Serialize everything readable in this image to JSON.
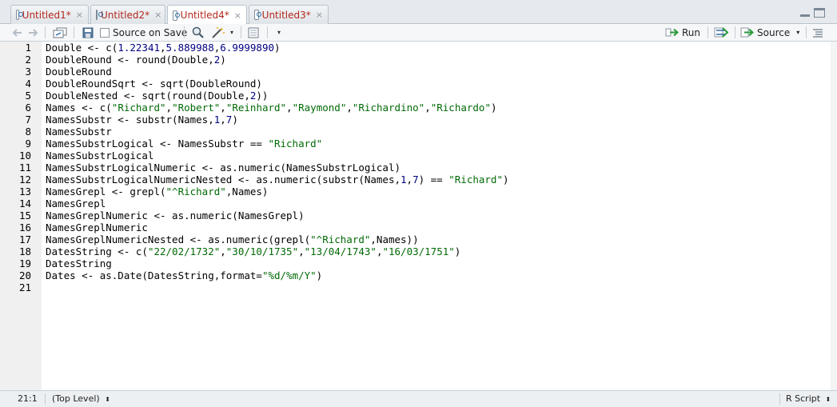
{
  "tabs": [
    {
      "label": "Untitled1*",
      "close": "×"
    },
    {
      "label": "Untitled2*",
      "close": "×"
    },
    {
      "label": "Untitled4*",
      "close": "×"
    },
    {
      "label": "Untitled3*",
      "close": "×"
    }
  ],
  "toolbar": {
    "source_on_save_label": "Source on Save",
    "run_label": "Run",
    "source_label": "Source"
  },
  "code": {
    "lines": [
      [
        {
          "t": "Double <- c("
        },
        {
          "t": "1.22341",
          "c": "n"
        },
        {
          "t": ","
        },
        {
          "t": "5.889988",
          "c": "n"
        },
        {
          "t": ","
        },
        {
          "t": "6.9999890",
          "c": "n"
        },
        {
          "t": ")"
        }
      ],
      [
        {
          "t": "DoubleRound <- round(Double,"
        },
        {
          "t": "2",
          "c": "n"
        },
        {
          "t": ")"
        }
      ],
      [
        {
          "t": "DoubleRound"
        }
      ],
      [
        {
          "t": "DoubleRoundSqrt <- sqrt(DoubleRound)"
        }
      ],
      [
        {
          "t": "DoubleNested <- sqrt(round(Double,"
        },
        {
          "t": "2",
          "c": "n"
        },
        {
          "t": "))"
        }
      ],
      [
        {
          "t": "Names <- c("
        },
        {
          "t": "\"Richard\"",
          "c": "s"
        },
        {
          "t": ","
        },
        {
          "t": "\"Robert\"",
          "c": "s"
        },
        {
          "t": ","
        },
        {
          "t": "\"Reinhard\"",
          "c": "s"
        },
        {
          "t": ","
        },
        {
          "t": "\"Raymond\"",
          "c": "s"
        },
        {
          "t": ","
        },
        {
          "t": "\"Richardino\"",
          "c": "s"
        },
        {
          "t": ","
        },
        {
          "t": "\"Richardo\"",
          "c": "s"
        },
        {
          "t": ")"
        }
      ],
      [
        {
          "t": "NamesSubstr <- substr(Names,"
        },
        {
          "t": "1",
          "c": "n"
        },
        {
          "t": ","
        },
        {
          "t": "7",
          "c": "n"
        },
        {
          "t": ")"
        }
      ],
      [
        {
          "t": "NamesSubstr"
        }
      ],
      [
        {
          "t": "NamesSubstrLogical <- NamesSubstr == "
        },
        {
          "t": "\"Richard\"",
          "c": "s"
        }
      ],
      [
        {
          "t": "NamesSubstrLogical"
        }
      ],
      [
        {
          "t": "NamesSubstrLogicalNumeric <- as.numeric(NamesSubstrLogical)"
        }
      ],
      [
        {
          "t": "NamesSubstrLogicalNumericNested <- as.numeric(substr(Names,"
        },
        {
          "t": "1",
          "c": "n"
        },
        {
          "t": ","
        },
        {
          "t": "7",
          "c": "n"
        },
        {
          "t": ") == "
        },
        {
          "t": "\"Richard\"",
          "c": "s"
        },
        {
          "t": ")"
        }
      ],
      [
        {
          "t": "NamesGrepl <- grepl("
        },
        {
          "t": "\"^Richard\"",
          "c": "s"
        },
        {
          "t": ",Names)"
        }
      ],
      [
        {
          "t": "NamesGrepl"
        }
      ],
      [
        {
          "t": "NamesGreplNumeric <- as.numeric(NamesGrepl)"
        }
      ],
      [
        {
          "t": "NamesGreplNumeric"
        }
      ],
      [
        {
          "t": "NamesGreplNumericNested <- as.numeric(grepl("
        },
        {
          "t": "\"^Richard\"",
          "c": "s"
        },
        {
          "t": ",Names))"
        }
      ],
      [
        {
          "t": "DatesString <- c("
        },
        {
          "t": "\"22/02/1732\"",
          "c": "s"
        },
        {
          "t": ","
        },
        {
          "t": "\"30/10/1735\"",
          "c": "s"
        },
        {
          "t": ","
        },
        {
          "t": "\"13/04/1743\"",
          "c": "s"
        },
        {
          "t": ","
        },
        {
          "t": "\"16/03/1751\"",
          "c": "s"
        },
        {
          "t": ")"
        }
      ],
      [
        {
          "t": "DatesString"
        }
      ],
      [
        {
          "t": "Dates <- as.Date(DatesString,format="
        },
        {
          "t": "\"%d/%m/Y\"",
          "c": "s"
        },
        {
          "t": ")"
        }
      ],
      []
    ]
  },
  "status": {
    "position": "21:1",
    "scope": "(Top Level)",
    "file_type": "R Script"
  },
  "colors": {
    "number": "#000080",
    "string": "#036a07",
    "tab_text": "#b3281e"
  }
}
